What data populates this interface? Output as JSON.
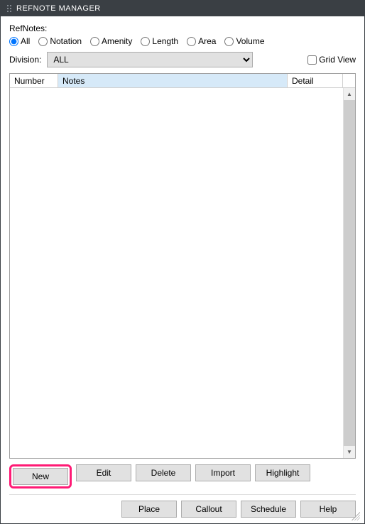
{
  "window": {
    "title": "REFNOTE MANAGER"
  },
  "labels": {
    "refnotes": "RefNotes:",
    "division": "Division:",
    "gridview": "Grid View"
  },
  "filters": {
    "all": "All",
    "notation": "Notation",
    "amenity": "Amenity",
    "length": "Length",
    "area": "Area",
    "volume": "Volume",
    "selected": "all"
  },
  "division": {
    "selected": "ALL",
    "options": [
      "ALL"
    ]
  },
  "columns": {
    "number": "Number",
    "notes": "Notes",
    "detail": "Detail"
  },
  "buttons": {
    "new": "New",
    "edit": "Edit",
    "delete": "Delete",
    "import": "Import",
    "highlight": "Highlight",
    "place": "Place",
    "callout": "Callout",
    "schedule": "Schedule",
    "help": "Help"
  },
  "annotation": {
    "highlight_target": "new-button",
    "color": "#ff1a75"
  }
}
